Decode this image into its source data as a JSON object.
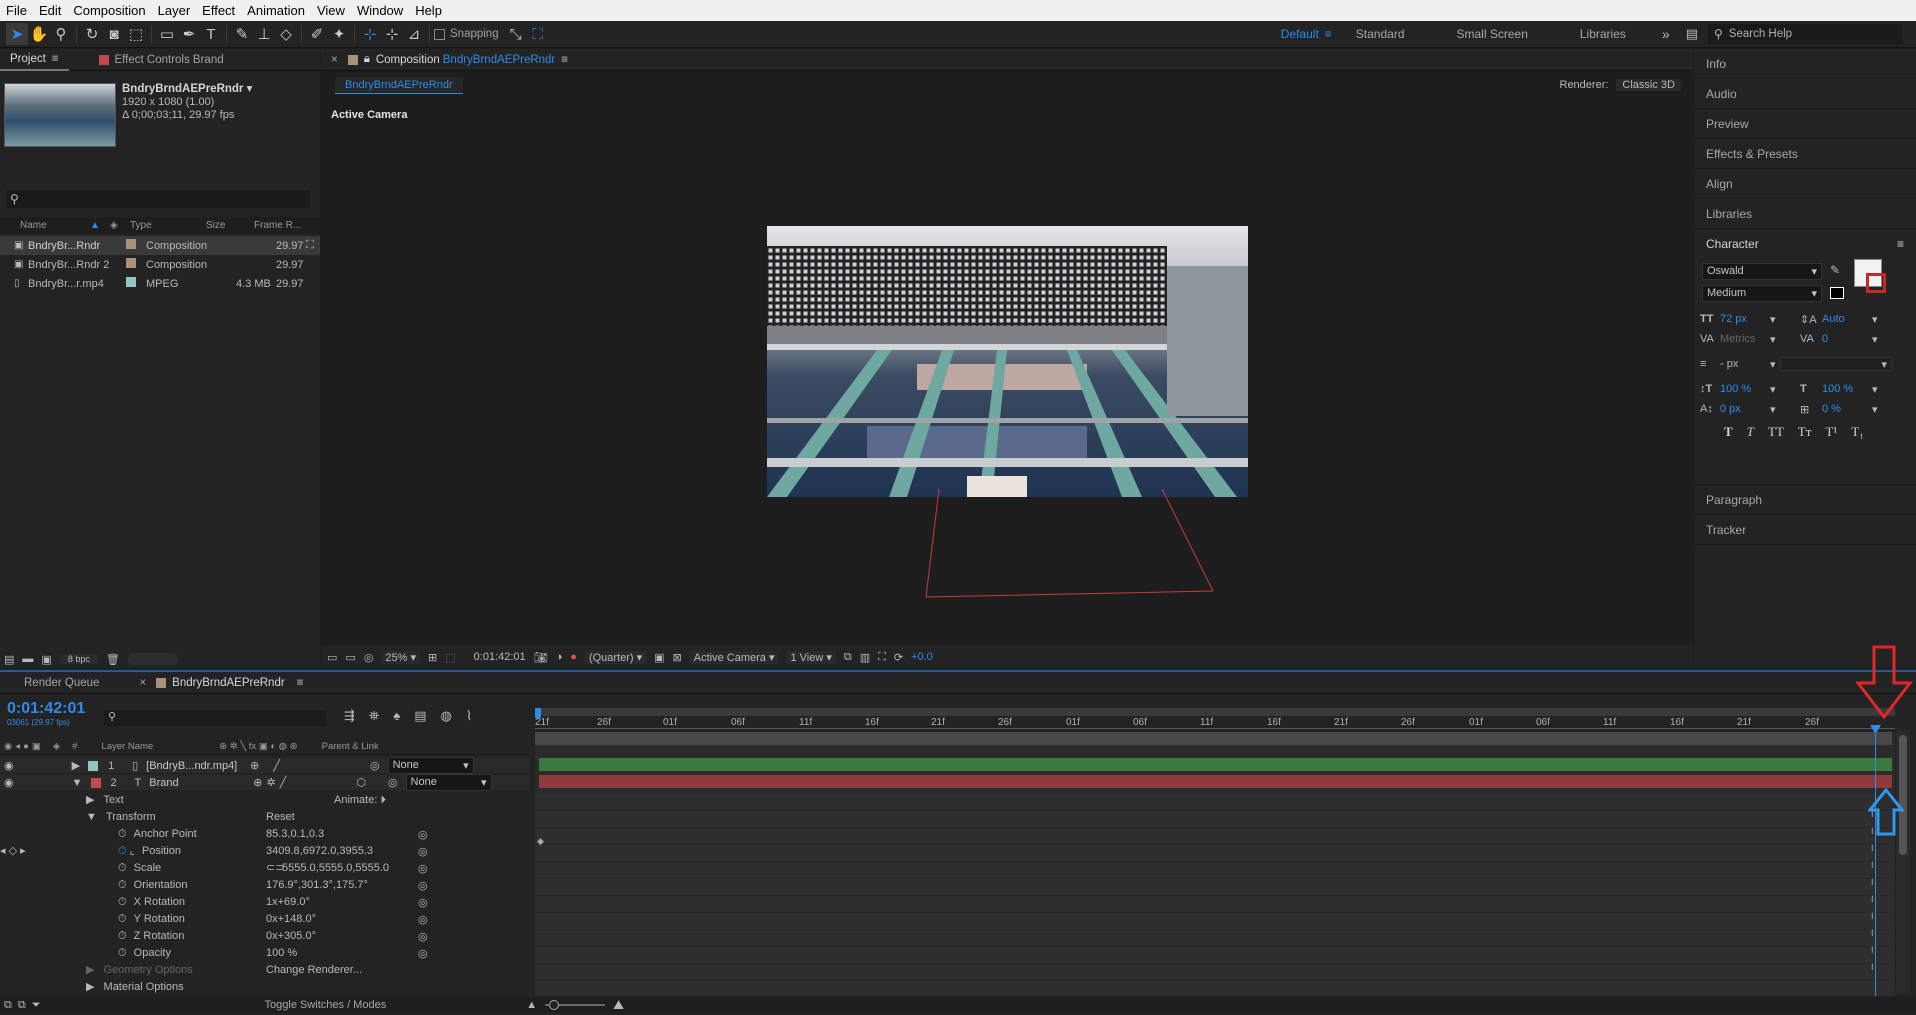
{
  "menu": [
    "File",
    "Edit",
    "Composition",
    "Layer",
    "Effect",
    "Animation",
    "View",
    "Window",
    "Help"
  ],
  "toolbar": {
    "snapping": "Snapping",
    "workspaces": [
      "Default",
      "Standard",
      "Small Screen",
      "Libraries"
    ],
    "search_placeholder": "Search Help"
  },
  "project": {
    "tab": "Project",
    "tab2": "Effect Controls Brand",
    "comp_name": "BndryBrndAEPreRndr",
    "comp_res": "1920 x 1080 (1.00)",
    "comp_dur": "Δ 0;00;03;11, 29.97 fps",
    "search_placeholder": "",
    "cols": [
      "Name",
      "Type",
      "Size",
      "Frame R..."
    ],
    "items": [
      {
        "name": "BndryBr...Rndr",
        "type": "Composition",
        "size": "",
        "fps": "29.97",
        "color": "#a8917b"
      },
      {
        "name": "BndryBr...Rndr 2",
        "type": "Composition",
        "size": "",
        "fps": "29.97",
        "color": "#a8917b"
      },
      {
        "name": "BndryBr...r.mp4",
        "type": "MPEG",
        "size": "4.3 MB",
        "fps": "29.97",
        "color": "#90c7c0"
      }
    ],
    "bpc": "8 bpc"
  },
  "comp": {
    "tab_prefix": "Composition",
    "tab_name": "BndryBrndAEPreRndr",
    "subtab": "BndryBrndAEPreRndr",
    "renderer_label": "Renderer:",
    "renderer": "Classic 3D",
    "view_label": "Active Camera",
    "bottom": {
      "zoom": "25%",
      "time": "0:01:42:01",
      "res": "(Quarter)",
      "camera": "Active Camera",
      "views": "1 View",
      "exposure": "+0.0"
    }
  },
  "right": {
    "items": [
      "Info",
      "Audio",
      "Preview",
      "Effects & Presets",
      "Align",
      "Libraries"
    ],
    "character": {
      "title": "Character",
      "font": "Oswald",
      "style": "Medium",
      "size": "72 px",
      "leading": "Auto",
      "kerning": "Metrics",
      "tracking": "0",
      "stroke": "- px",
      "vscale": "100 %",
      "hscale": "100 %",
      "baseline": "0 px",
      "tsume": "0 %",
      "styles": [
        "T",
        "T",
        "TT",
        "Tт",
        "T¹",
        "T₁"
      ]
    },
    "items2": [
      "Paragraph",
      "Tracker"
    ]
  },
  "timeline": {
    "tab1": "Render Queue",
    "tab2": "BndryBrndAEPreRndr",
    "timecode": "0:01:42:01",
    "frames": "03061 (29.97 fps)",
    "ruler": [
      "21f",
      "26f",
      "01f",
      "06f",
      "11f",
      "16f",
      "21f",
      "26f",
      "01f",
      "06f",
      "11f",
      "16f",
      "21f",
      "26f",
      "01f",
      "06f",
      "11f",
      "16f",
      "21f",
      "26f"
    ],
    "headers": {
      "num": "#",
      "layer": "Layer Name",
      "parent": "Parent & Link"
    },
    "layers": [
      {
        "num": "1",
        "name": "[BndryB...ndr.mp4]",
        "parent": "None",
        "color": "#90c7c0",
        "bar": "#3b7a3d"
      },
      {
        "num": "2",
        "name": "Brand",
        "parent": "None",
        "color": "#c34a4a",
        "bar": "#8e3a3e"
      }
    ],
    "animate": "Animate:",
    "groups": {
      "text": "Text",
      "transform": "Transform",
      "reset": "Reset",
      "geometry": "Geometry Options",
      "change_renderer": "Change Renderer...",
      "material": "Material Options"
    },
    "props": [
      {
        "name": "Anchor Point",
        "value": "85.3,0.1,0.3"
      },
      {
        "name": "Position",
        "value": "3409.8,6972.0,3955.3"
      },
      {
        "name": "Scale",
        "value": "5555.0,5555.0,5555.0"
      },
      {
        "name": "Orientation",
        "value": "176.9°,301.3°,175.7°"
      },
      {
        "name": "X Rotation",
        "value": "1x+69.0°"
      },
      {
        "name": "Y Rotation",
        "value": "0x+148.0°"
      },
      {
        "name": "Z Rotation",
        "value": "0x+305.0°"
      },
      {
        "name": "Opacity",
        "value": "100 %"
      }
    ],
    "footer": "Toggle Switches / Modes"
  }
}
